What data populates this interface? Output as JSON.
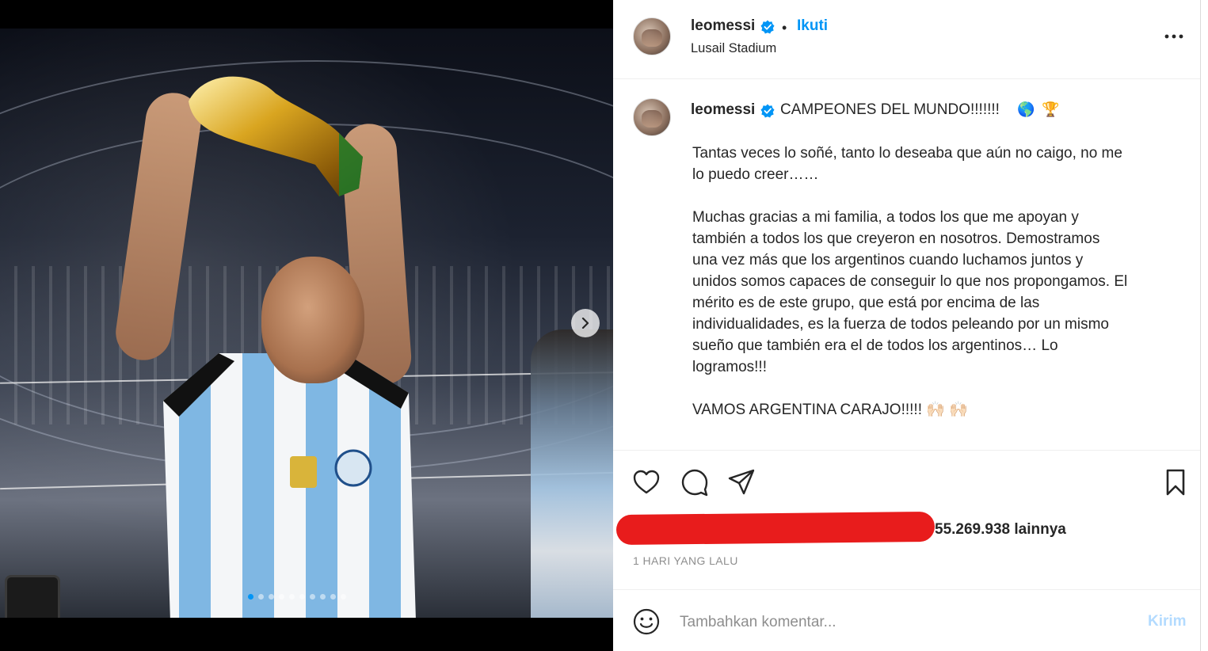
{
  "post": {
    "username": "leomessi",
    "follow_separator": "•",
    "follow_label": "Ikuti",
    "location": "Lusail Stadium",
    "more_icon": "more-horizontal-icon"
  },
  "caption": {
    "username": "leomessi",
    "headline": "CAMPEONES DEL MUNDO!!!!!!!",
    "headline_emojis": [
      "🌎",
      "🏆"
    ],
    "paragraphs": [
      "Tantas veces lo soñé, tanto lo deseaba que aún no caigo, no me\nlo puedo creer……",
      "Muchas gracias a mi familia, a todos los que me apoyan y\ntambién a todos los que creyeron en nosotros. Demostramos\nuna vez más que los argentinos cuando luchamos juntos y\nunidos somos capaces de conseguir lo que nos propongamos. El\nmérito es de este grupo, que está por encima de las\nindividualidades, es la fuerza de todos peleando por un mismo\nsueño que también era el de todos los argentinos… Lo\nlogramos!!!",
      "VAMOS ARGENTINA CARAJO!!!!! 🙌🏻 🙌🏻"
    ]
  },
  "actions": {
    "icons": [
      "heart-icon",
      "comment-icon",
      "share-icon",
      "bookmark-icon"
    ]
  },
  "likes": {
    "text": "55.269.938 lainnya"
  },
  "timestamp": "1 HARI YANG LALU",
  "comment": {
    "placeholder": "Tambahkan komentar...",
    "post_label": "Kirim"
  },
  "carousel": {
    "total_slides": 10,
    "active_index": 0
  },
  "colors": {
    "accent": "#0095f6",
    "disabled_accent": "#b3dbff",
    "redaction": "#e81c1c"
  }
}
